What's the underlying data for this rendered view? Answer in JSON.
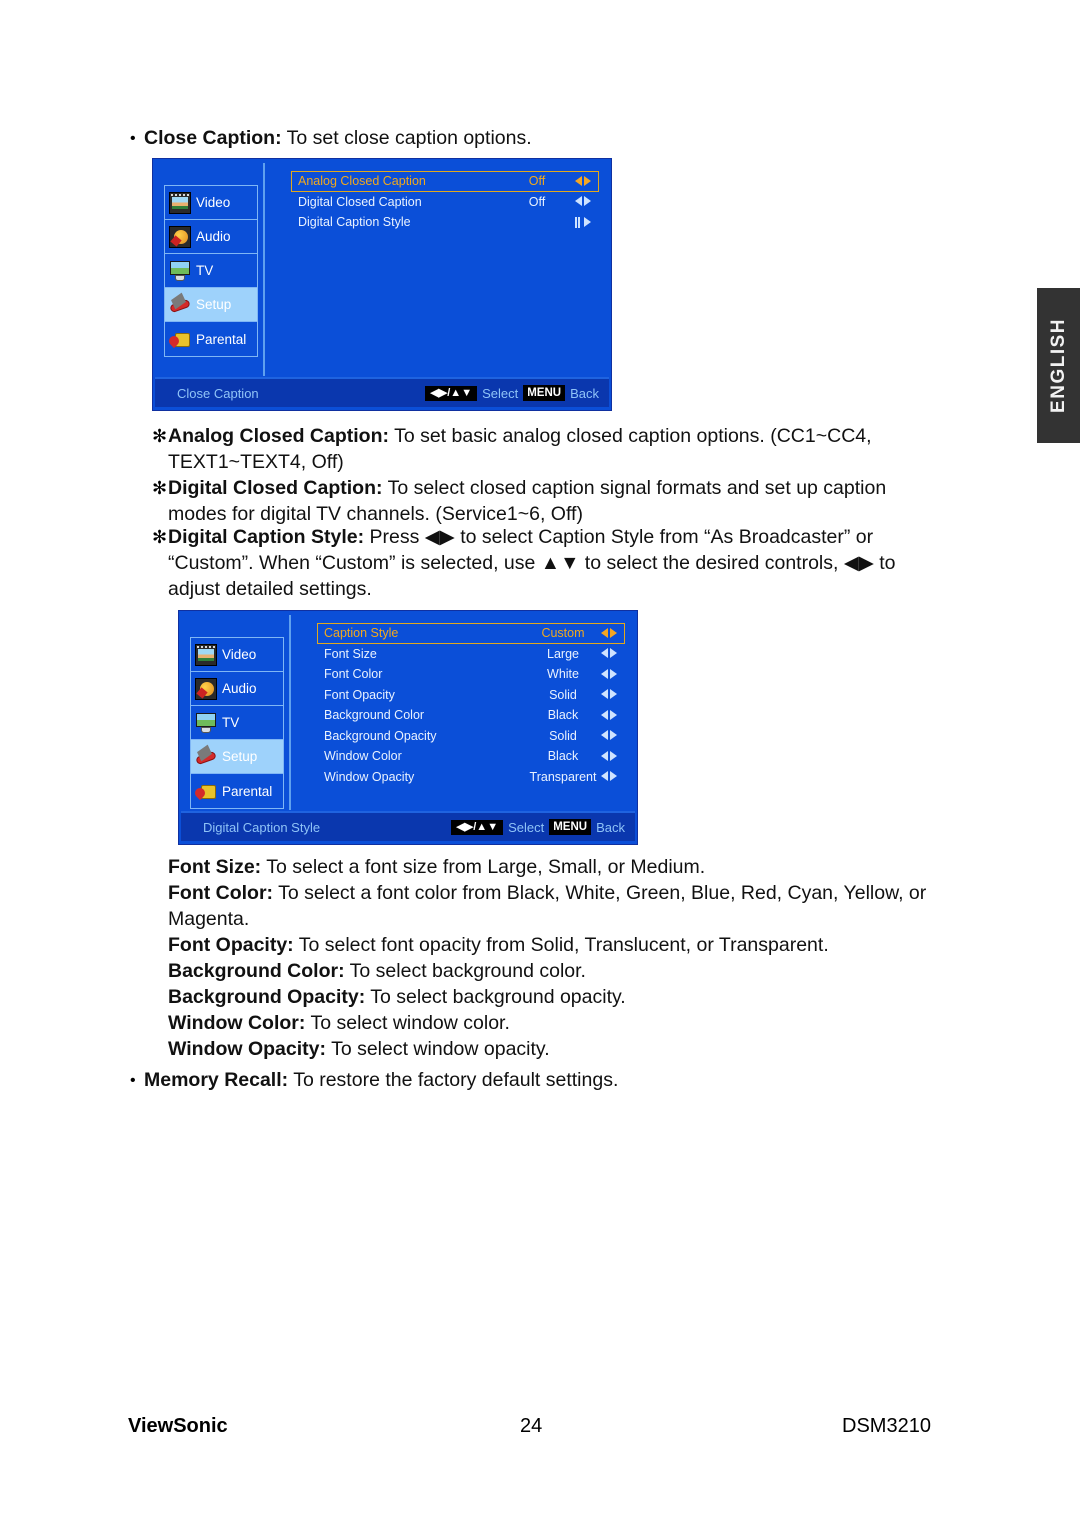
{
  "page": {
    "lang_tab": "ENGLISH",
    "brand": "ViewSonic",
    "page_number": "24",
    "model": "DSM3210"
  },
  "sections": {
    "close_caption": {
      "bullet": "•",
      "term": "Close Caption:",
      "desc": " To set close caption options."
    },
    "analog_cc": {
      "star": "✻",
      "term": "Analog Closed Caption:",
      "line1": " To set basic analog closed caption options. (CC1~CC4,",
      "line2": "TEXT1~TEXT4, Off)"
    },
    "digital_cc": {
      "star": "✻",
      "term": "Digital Closed Caption:",
      "line1": " To select closed caption signal formats and set up caption",
      "line2": "modes for digital TV channels. (Service1~6, Off)"
    },
    "digital_style": {
      "star": "✻",
      "term": "Digital Caption Style:",
      "line1": " Press ◀▶ to select Caption Style from “As Broadcaster” or",
      "line2": "“Custom”. When “Custom” is selected, use ▲▼ to select the desired controls, ◀▶ to",
      "line3": "adjust detailed settings."
    },
    "style_defs": [
      {
        "term": "Font Size:",
        "desc": " To select a font size from Large, Small, or Medium."
      },
      {
        "term": "Font Color:",
        "desc": " To select a font color from Black, White, Green, Blue, Red, Cyan, Yellow, or",
        "desc2": "Magenta."
      },
      {
        "term": "Font Opacity:",
        "desc": " To select font opacity from Solid, Translucent, or Transparent."
      },
      {
        "term": "Background Color:",
        "desc": " To select background color."
      },
      {
        "term": "Background Opacity:",
        "desc": " To select background opacity."
      },
      {
        "term": "Window Color:",
        "desc": " To select window color."
      },
      {
        "term": "Window Opacity:",
        "desc": " To select window opacity."
      }
    ],
    "memory_recall": {
      "bullet": "•",
      "term": "Memory Recall:",
      "desc": " To restore the factory default settings."
    }
  },
  "osd_menu_1": {
    "sidebar": [
      {
        "label": "Video",
        "icon": "video-icon",
        "active": false
      },
      {
        "label": "Audio",
        "icon": "audio-icon",
        "active": false
      },
      {
        "label": "TV",
        "icon": "tv-icon",
        "active": false
      },
      {
        "label": "Setup",
        "icon": "setup-icon",
        "active": true
      },
      {
        "label": "Parental",
        "icon": "parental-icon",
        "active": false
      }
    ],
    "options": [
      {
        "label": "Analog Closed Caption",
        "value": "Off",
        "arrow": "left-right-arrow-icon",
        "selected": true
      },
      {
        "label": "Digital Closed Caption",
        "value": "Off",
        "arrow": "left-right-arrow-icon",
        "selected": false
      },
      {
        "label": "Digital Caption Style",
        "value": "",
        "arrow": "enter-arrow-icon",
        "selected": false
      }
    ],
    "footer": {
      "title": "Close Caption",
      "keys": "◀▶/▲▼",
      "select": "Select",
      "menu_key": "MENU",
      "back": "Back"
    }
  },
  "osd_menu_2": {
    "sidebar": [
      {
        "label": "Video",
        "icon": "video-icon",
        "active": false
      },
      {
        "label": "Audio",
        "icon": "audio-icon",
        "active": false
      },
      {
        "label": "TV",
        "icon": "tv-icon",
        "active": false
      },
      {
        "label": "Setup",
        "icon": "setup-icon",
        "active": true
      },
      {
        "label": "Parental",
        "icon": "parental-icon",
        "active": false
      }
    ],
    "options": [
      {
        "label": "Caption Style",
        "value": "Custom",
        "arrow": "left-right-arrow-icon",
        "selected": true
      },
      {
        "label": "Font Size",
        "value": "Large",
        "arrow": "left-right-arrow-icon",
        "selected": false
      },
      {
        "label": "Font Color",
        "value": "White",
        "arrow": "left-right-arrow-icon",
        "selected": false
      },
      {
        "label": "Font Opacity",
        "value": "Solid",
        "arrow": "left-right-arrow-icon",
        "selected": false
      },
      {
        "label": "Background Color",
        "value": "Black",
        "arrow": "left-right-arrow-icon",
        "selected": false
      },
      {
        "label": "Background Opacity",
        "value": "Solid",
        "arrow": "left-right-arrow-icon",
        "selected": false
      },
      {
        "label": "Window Color",
        "value": "Black",
        "arrow": "left-right-arrow-icon",
        "selected": false
      },
      {
        "label": "Window Opacity",
        "value": "Transparent",
        "arrow": "left-right-arrow-icon",
        "selected": false
      }
    ],
    "footer": {
      "title": "Digital Caption Style",
      "keys": "◀▶/▲▼",
      "select": "Select",
      "menu_key": "MENU",
      "back": "Back"
    }
  },
  "colors": {
    "osd_blue": "#0b4fd8",
    "osd_footer_blue": "#0a37ae",
    "highlight_gold": "#e0a81e",
    "active_row_blue": "#9ed2fb",
    "lang_tab_gray": "#333333"
  }
}
